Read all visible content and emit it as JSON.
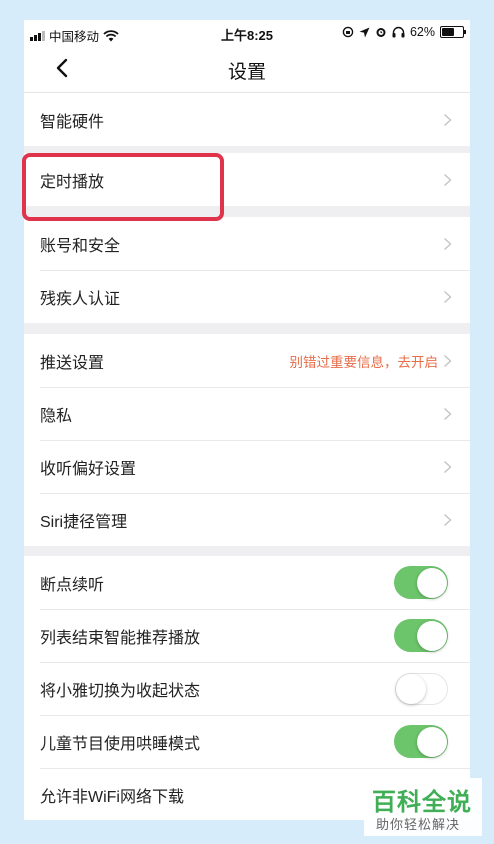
{
  "status_bar": {
    "carrier": "中国移动",
    "time": "上午8:25",
    "battery_percent": "62%",
    "battery_level": 0.62,
    "icons": [
      "signal-icon",
      "wifi-icon",
      "orientation-lock-icon",
      "location-icon",
      "alarm-icon",
      "headphones-icon",
      "battery-icon"
    ]
  },
  "nav": {
    "title": "设置",
    "back_icon": "chevron-left-icon"
  },
  "groups": {
    "g1": {
      "items": [
        {
          "label": "智能硬件"
        }
      ]
    },
    "g2": {
      "items": [
        {
          "label": "定时播放"
        }
      ]
    },
    "g3": {
      "items": [
        {
          "label": "账号和安全"
        },
        {
          "label": "残疾人认证"
        }
      ]
    },
    "g4": {
      "items": [
        {
          "label": "推送设置",
          "hint": "别错过重要信息，去开启"
        },
        {
          "label": "隐私"
        },
        {
          "label": "收听偏好设置"
        },
        {
          "label": "Siri捷径管理"
        }
      ]
    },
    "g5": {
      "items": [
        {
          "label": "断点续听",
          "toggle": "on"
        },
        {
          "label": "列表结束智能推荐播放",
          "toggle": "on"
        },
        {
          "label": "将小雅切换为收起状态",
          "toggle": "off"
        },
        {
          "label": "儿童节目使用哄睡模式",
          "toggle": "on"
        },
        {
          "label": "允许非WiFi网络下载"
        }
      ]
    }
  },
  "colors": {
    "toggle_on": "#6cc46b",
    "hint_text": "#e86d49",
    "highlight": "#e0334c",
    "background": "#d6ecfa"
  },
  "watermark": {
    "title": "百科全说",
    "subtitle": "助你轻松解决"
  }
}
